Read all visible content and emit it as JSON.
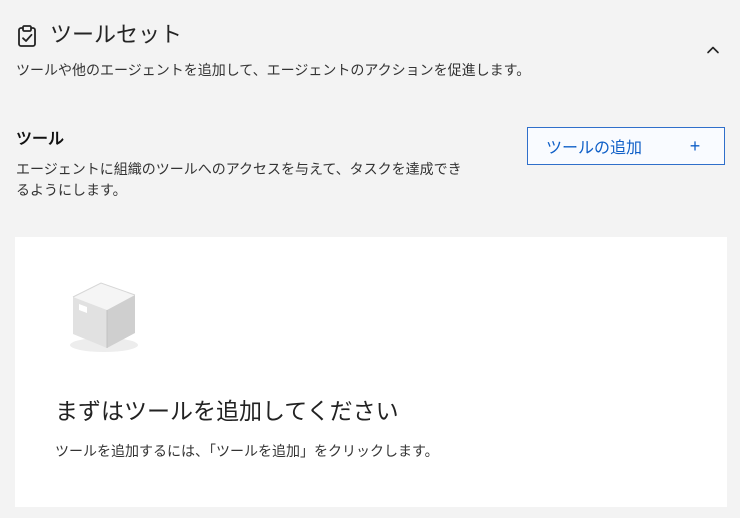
{
  "header": {
    "icon": "clipboard-check-icon",
    "title": "ツールセット",
    "subtitle": "ツールや他のエージェントを追加して、エージェントのアクションを促進します。",
    "collapse_icon": "chevron-up-icon"
  },
  "tools": {
    "heading": "ツール",
    "description": "エージェントに組織のツールへのアクセスを与えて、タスクを達成できるようにします。",
    "add_button_label": "ツールの追加",
    "add_button_icon": "plus-icon"
  },
  "empty_state": {
    "illustration": "box-icon",
    "title": "まずはツールを追加してください",
    "text": "ツールを追加するには、「ツールを追加」をクリックします。"
  },
  "colors": {
    "background": "#f3f3f3",
    "card": "#ffffff",
    "accent": "#0f5fc7",
    "text": "#242424"
  }
}
